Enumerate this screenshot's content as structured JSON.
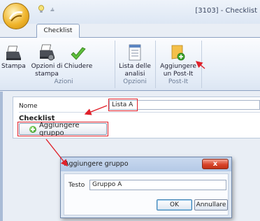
{
  "window": {
    "title": "[3103] - Checklist",
    "active_tab": "Checklist"
  },
  "ribbon": {
    "buttons": [
      {
        "label": "Stampa",
        "icon": "printer-icon"
      },
      {
        "label": "Opzioni di stampa",
        "icon": "printer-settings-icon"
      },
      {
        "label": "Chiudere",
        "icon": "checkmark-icon"
      },
      {
        "label": "Lista delle analisi",
        "icon": "list-document-icon"
      },
      {
        "label": "Aggiungere un Post-It",
        "icon": "post-it-add-icon"
      }
    ],
    "groups": [
      "Azioni",
      "Opzioni",
      "Post-It"
    ]
  },
  "form": {
    "nome_label": "Nome",
    "nome_value": "Lista A",
    "checklist_label": "Checklist",
    "add_group_label": "Aggiungere gruppo"
  },
  "dialog": {
    "title": "Aggiungere gruppo",
    "close_glyph": "x",
    "testo_label": "Testo",
    "testo_value": "Gruppo A",
    "ok_label": "OK",
    "cancel_label": "Annullare"
  },
  "colors": {
    "annotation_red": "#e0202a",
    "ribbon_border": "#8da2c2"
  }
}
